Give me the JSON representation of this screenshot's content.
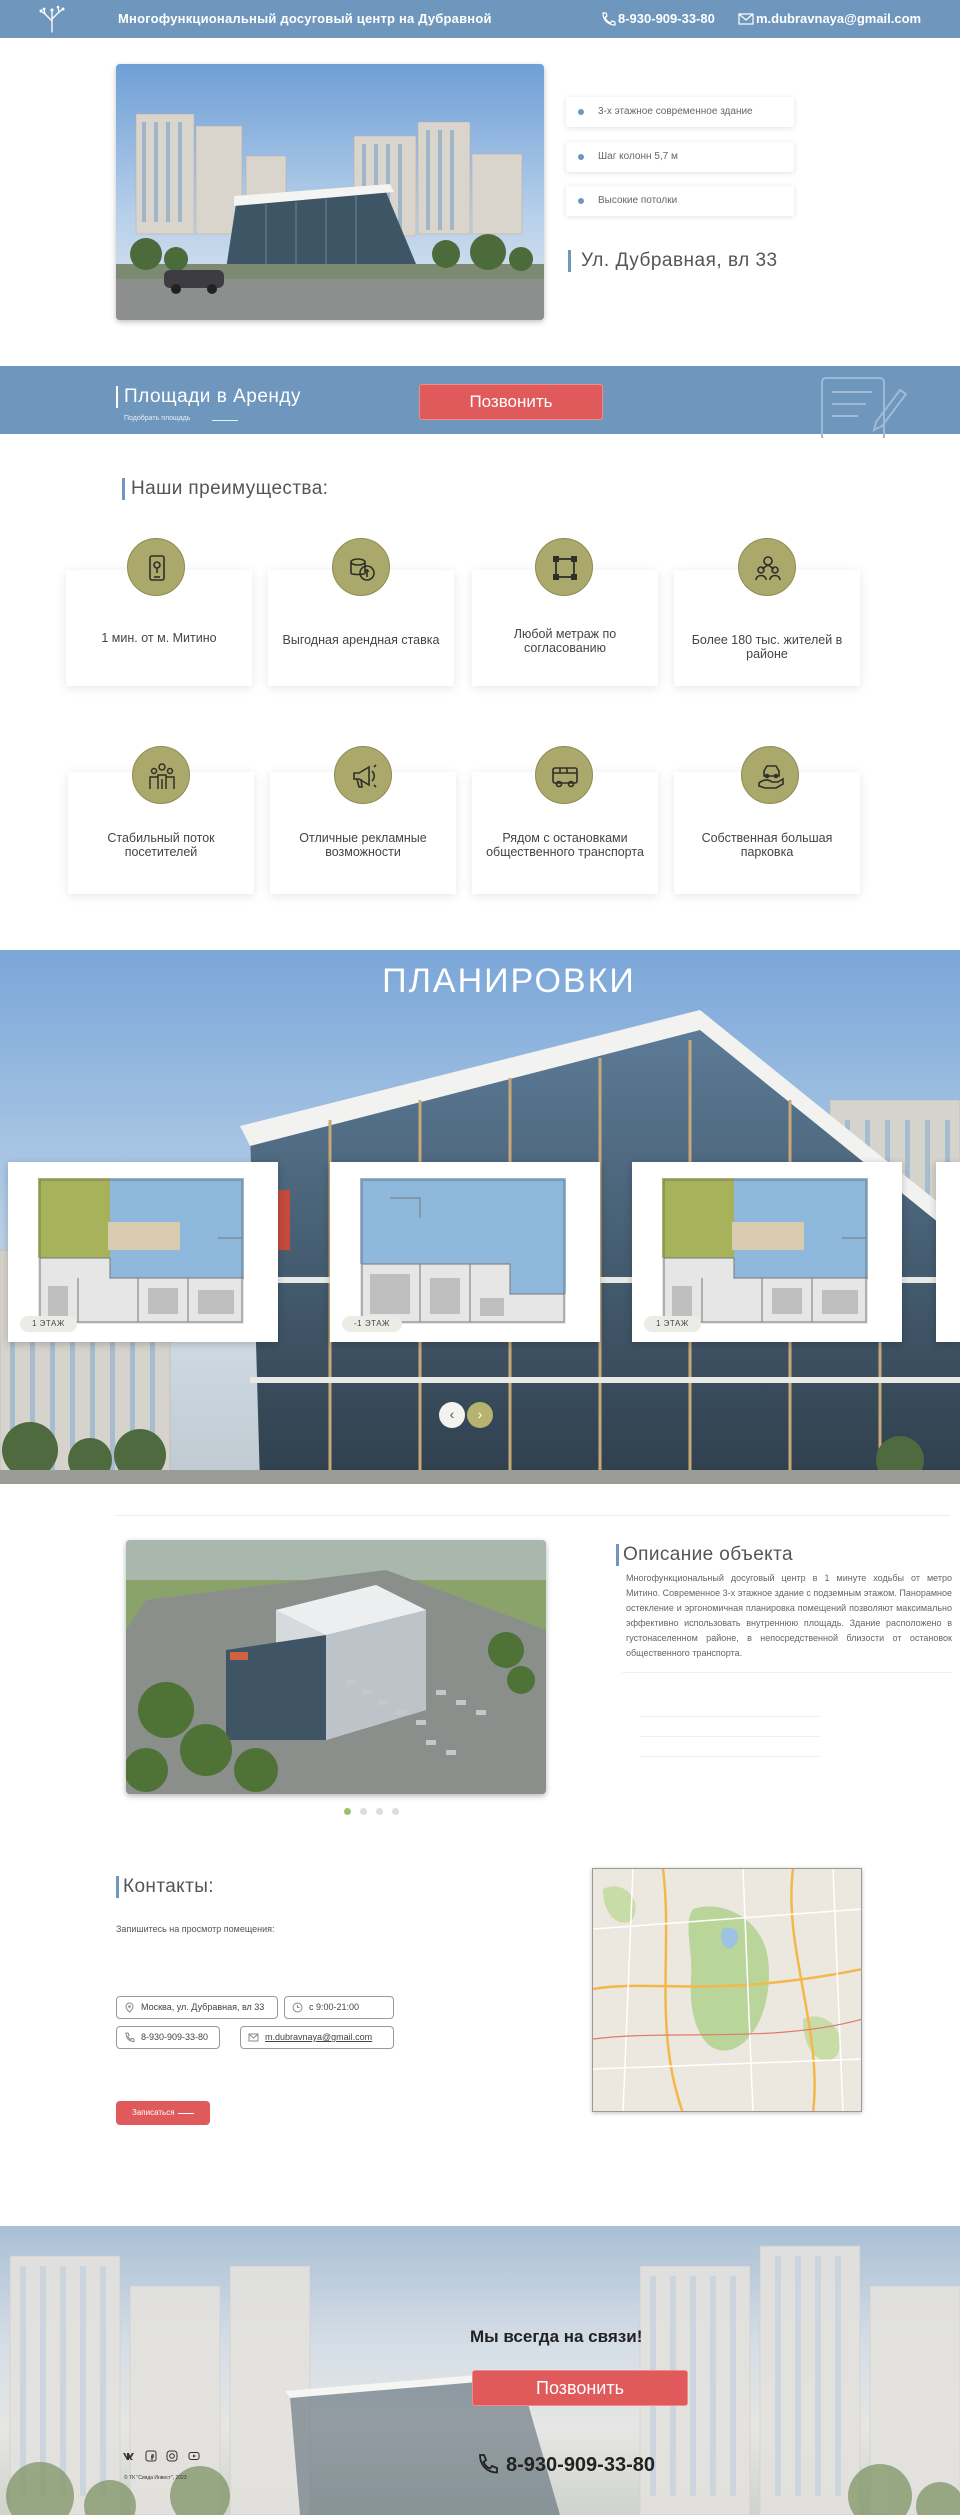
{
  "header": {
    "logo_icon": "tree-logo-icon",
    "title": "Многофункциональный досуговый центр на Дубравной",
    "phone": "8-930-909-33-80",
    "email": "m.dubravnaya@gmail.com",
    "background": "#6f97bd"
  },
  "hero": {
    "features": [
      "3-х этажное современное здание",
      "Шаг колонн 5,7 м",
      "Высокие потолки"
    ],
    "address": "Ул. Дубравная, вл 33"
  },
  "rent": {
    "title": "Площади в Аренду",
    "subtitle": "Подобрать площадь",
    "call_label": "Позвонить"
  },
  "advantages": {
    "title": "Наши преимущества:",
    "items": [
      {
        "label": "1 мин. от м. Митино",
        "icon": "map-phone-icon"
      },
      {
        "label": "Выгодная арендная ставка",
        "icon": "coins-icon"
      },
      {
        "label": "Любой метраж по согласованию",
        "icon": "area-square-icon"
      },
      {
        "label": "Более 180 тыс. жителей в районе",
        "icon": "people-group-icon"
      },
      {
        "label": "Стабильный поток посетителей",
        "icon": "crowd-icon"
      },
      {
        "label": "Отличные рекламные возможности",
        "icon": "megaphone-icon"
      },
      {
        "label": "Рядом с остановками общественного транспорта",
        "icon": "bus-icon"
      },
      {
        "label": "Собственная большая парковка",
        "icon": "car-hand-icon"
      }
    ],
    "accent": "#aaa86a"
  },
  "layouts": {
    "title": "ПЛАНИРОВКИ",
    "plans": [
      "1 ЭТАЖ",
      "-1 ЭТАЖ",
      "1 ЭТАЖ"
    ],
    "prev_icon": "chevron-left-icon",
    "next_icon": "chevron-right-icon"
  },
  "description": {
    "title": "Описание объекта",
    "text": "Многофункциональный досуговый центр в 1 минуте ходьбы от метро Митино. Современное 3-х этажное здание с подземным этажом. Панорамное остекление и эргономичная планировка помещений позволяют максимально эффективно использовать внутреннюю площадь. Здание расположено в густонаселенном районе, в непосредственной близости от остановок общественного транспорта."
  },
  "contacts": {
    "title": "Контакты:",
    "subtitle": "Запишитесь на просмотр помещения:",
    "address": "Москва, ул. Дубравная, вл 33",
    "hours": "с 9:00-21:00",
    "phone": "8-930-909-33-80",
    "email": "m.dubravnaya@gmail.com",
    "signup_label": "Записаться"
  },
  "footer": {
    "title": "Мы всегда на связи!",
    "call_label": "Позвонить",
    "phone": "8-930-909-33-80",
    "social": [
      "vk-icon",
      "facebook-icon",
      "instagram-icon",
      "youtube-icon"
    ],
    "copyright": "© ТК \"Сияда Инвест\", 2023"
  },
  "colors": {
    "primary": "#6f97bd",
    "button": "#e05a5c",
    "accent_olive": "#aaa86a"
  }
}
